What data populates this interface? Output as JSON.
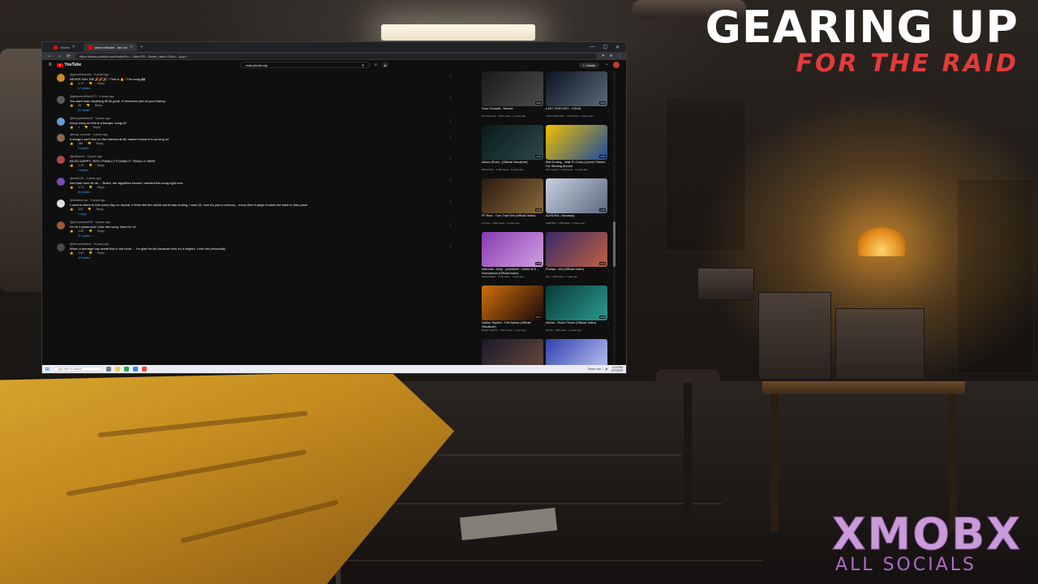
{
  "overlay": {
    "title_line1": "GEARING UP",
    "title_line2": "FOR THE RAID",
    "channel": "XMOBX",
    "channel_sub": "ALL SOCIALS"
  },
  "browser": {
    "tabs": [
      {
        "label": "Shorts"
      },
      {
        "label": "pierce theatre - fan vid"
      }
    ],
    "new_tab": "+",
    "controls": {
      "minimize": "—",
      "maximize": "☐",
      "close": "✕"
    },
    "url": "https://www.youtube.com/watch?v=...&list=RD...&start_radio=1&rv=...&pp=...",
    "nav": {
      "back": "←",
      "forward": "→",
      "reload": "⟳"
    }
  },
  "youtube": {
    "logo": "YouTube",
    "search_value": "mae phonk rap",
    "search_clear": "✕",
    "create_label": "+ Create",
    "icons": {
      "bell": "🔔",
      "search": "⌕",
      "mic": "🎙",
      "menu": "≡"
    }
  },
  "comments": [
    {
      "avatar_color": "#c98a2a",
      "author": "@geewhitesnake · 6 years ago",
      "text": "NEVER SAY DIE 🎉🎉🎉 / This is 🔥 / The song 🙌🏻",
      "likes": "4.7K",
      "reply": "Reply",
      "replies": "17 replies"
    },
    {
      "avatar_color": "#5a5a5a",
      "author": "@getsomeofthis1973 · 5 years ago",
      "text": "You dont learn anything till its gone. It becomes part of your history.",
      "likes": "2K",
      "reply": "Reply",
      "replies": "22 replies"
    },
    {
      "avatar_color": "#6a9bd1",
      "author": "@the.goldenboi02 · 5 years ago",
      "text": "every song on this is a banger, song #3",
      "likes": "1",
      "reply": "Reply",
      "replies": ""
    },
    {
      "avatar_color": "#8a6a4a",
      "author": "@boyd_sommer · 4 years ago",
      "text": "6 songs i can't find on the internet at all, haven't found it in so long lol",
      "likes": "288",
      "reply": "Reply",
      "replies": "9 replies"
    },
    {
      "avatar_color": "#b04a4a",
      "author": "@jwilliams3 · 5 years ago",
      "text": "IM SO HAPPY, YES! I FINALLY FOUND IT, FINALLY HERE",
      "likes": "1.1K",
      "reply": "Reply",
      "replies": "4 replies"
    },
    {
      "avatar_color": "#7a4ab0",
      "author": "@bad4135 · 4 years ago",
      "text": "Not from here its ok ... Brazil, the algorithm knows I needed this song right now",
      "likes": "1.7K",
      "reply": "Reply",
      "replies": "46 replies"
    },
    {
      "avatar_color": "#e0e0e0",
      "author": "@whatever.ya · 3 years ago",
      "text": "I used to listen to this every day on repeat, it feels like the whole world was ending, I was 15, now it's just a memory... every time it plays it takes me back to that place",
      "likes": "224",
      "reply": "Reply",
      "replies": "1 reply"
    },
    {
      "avatar_color": "#9a5a3a",
      "author": "@johnnybravo999 · 5 years ago",
      "text": "Hi I'm 9 years and i love this song. Now i'm 14.",
      "likes": "3.6K",
      "reply": "Reply",
      "replies": "37 replies"
    },
    {
      "avatar_color": "#4a4a4a",
      "author": "@eternal.dreams · 6 years ago",
      "text": "When a teenage boy made this in his room ... I'm glad he did because now it's a legend. Love her personally.",
      "likes": "4.6K",
      "reply": "Reply",
      "replies": "42 replies"
    }
  ],
  "recommendations": [
    {
      "title": "Face Yourself - Stoned",
      "meta": "Tour Records · 787K views · 2 years ago",
      "duration": "3:02",
      "c1": "#1a1a1a",
      "c2": "#4a4a4a"
    },
    {
      "title": "LAST CENTURY - VIXXA",
      "meta": "LAST CENTURY · 1.1M views · 3 years ago",
      "duration": "3:40",
      "c1": "#0c1420",
      "c2": "#5a6a7a"
    },
    {
      "title": "Ashes (Ruin) - [Official Visualizer]",
      "meta": "Ashes Ruin · 2.1M views · 2 years ago",
      "duration": "4:12",
      "c1": "#0a1a1a",
      "c2": "#2a4a48"
    },
    {
      "title": "Bad Ending - Wait To Crazy (Lyrics) Thanks For Sticking Around",
      "meta": "Sun Leaves · 1.1M views · 4 years ago",
      "duration": "3:35",
      "c1": "#f0c000",
      "c2": "#1a4aa0"
    },
    {
      "title": "FF Ruin - Turn That Shit (Official Video)",
      "meta": "FF Ruin · 3.6M views · 5 years ago",
      "duration": "3:03",
      "c1": "#2a1a10",
      "c2": "#8a6a3a"
    },
    {
      "title": "AURORA - Runaway",
      "meta": "AURORA · 1.5B views · 9 years ago",
      "duration": "4:10",
      "c1": "#c8d0e0",
      "c2": "#5a6880"
    },
    {
      "title": "Interlude: Jump - phonkshit - chase at ft ... Scandalous (Official Audio)",
      "meta": "dariusbadgirl · 1.7M views · 1 year ago",
      "duration": "2:48",
      "c1": "#8a3ab0",
      "c2": "#d0a0e0"
    },
    {
      "title": "Pumpa - ziel (Official Video)",
      "meta": "ziel · 1.3M views · 1 year ago",
      "duration": "3:22",
      "c1": "#3a2a6a",
      "c2": "#c06040"
    },
    {
      "title": "Darker Skyline - Fall Asleep (Official Visualizer)",
      "meta": "Darker Skyline · 176K views · 1 year ago",
      "duration": "3:17",
      "c1": "#d0700a",
      "c2": "#1a0a0a"
    },
    {
      "title": "NaYas - Ruins Phone (Official Video)",
      "meta": "NaYas · 29M views · 2 years ago",
      "duration": "3:05",
      "c1": "#0a3a3a",
      "c2": "#2a9a90"
    },
    {
      "title": "",
      "meta": "",
      "duration": "",
      "c1": "#1a1a2a",
      "c2": "#6a4a3a"
    },
    {
      "title": "",
      "meta": "",
      "duration": "",
      "c1": "#3040b0",
      "c2": "#c0c8f0"
    }
  ],
  "taskbar": {
    "start": "⊞",
    "search_placeholder": "Type here to search",
    "clock_time": "4:24 PM",
    "clock_date": "8/7/2023",
    "tray": "Temps low  ⌃  🔊"
  }
}
